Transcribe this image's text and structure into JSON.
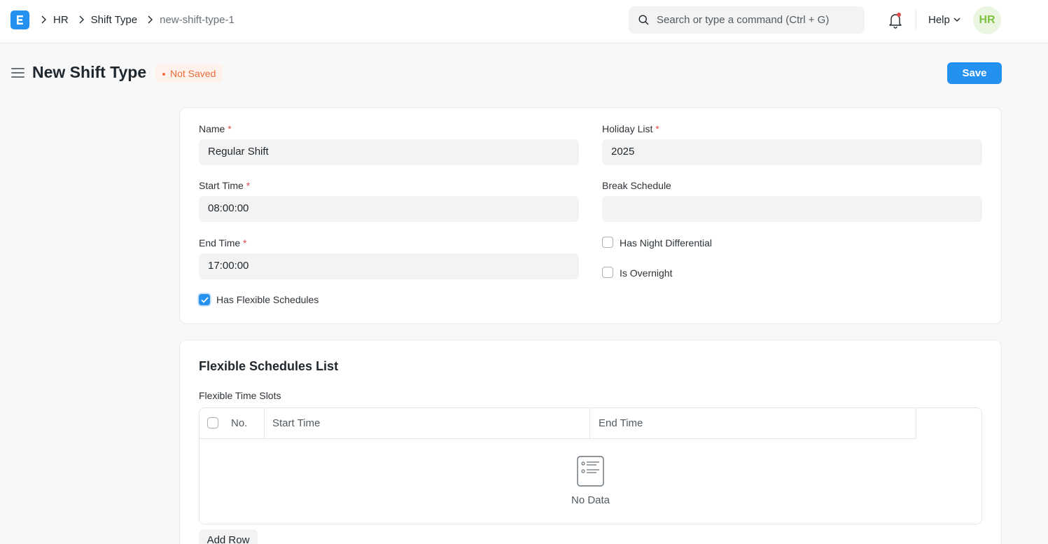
{
  "app": {
    "logo_letter": "E"
  },
  "breadcrumbs": [
    "HR",
    "Shift Type",
    "new-shift-type-1"
  ],
  "search": {
    "placeholder": "Search or type a command (Ctrl + G)"
  },
  "nav": {
    "help_label": "Help",
    "avatar_initials": "HR"
  },
  "page": {
    "title": "New Shift Type",
    "status": "Not Saved",
    "save_label": "Save"
  },
  "form": {
    "name": {
      "label": "Name",
      "value": "Regular Shift",
      "required": "*"
    },
    "holiday_list": {
      "label": "Holiday List",
      "value": "2025",
      "required": "*"
    },
    "start_time": {
      "label": "Start Time",
      "value": "08:00:00",
      "required": "*"
    },
    "break_schedule": {
      "label": "Break Schedule",
      "value": ""
    },
    "end_time": {
      "label": "End Time",
      "value": "17:00:00",
      "required": "*"
    },
    "has_night_differential": {
      "label": "Has Night Differential",
      "checked": false
    },
    "is_overnight": {
      "label": "Is Overnight",
      "checked": false
    },
    "has_flexible_schedules": {
      "label": "Has Flexible Schedules",
      "checked": true
    }
  },
  "flexible": {
    "section_title": "Flexible Schedules List",
    "table_label": "Flexible Time Slots",
    "columns": [
      "No.",
      "Start Time",
      "End Time"
    ],
    "rows": [],
    "empty_text": "No Data",
    "add_row_label": "Add Row"
  },
  "colors": {
    "accent": "#2490ef",
    "status_warning": "#e86c3a",
    "required": "#e24c4c"
  }
}
